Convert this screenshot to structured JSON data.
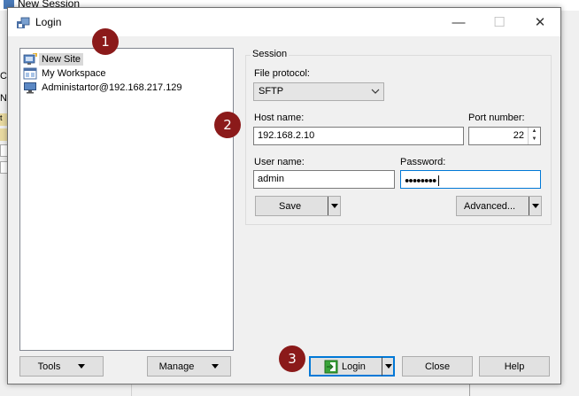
{
  "background_window": {
    "title": "New Session",
    "left_letters": [
      "C",
      "N",
      "t"
    ]
  },
  "dialog": {
    "title": "Login",
    "controls": {
      "minimize": "—",
      "maximize": "☐",
      "close": "✕"
    }
  },
  "tree": {
    "items": [
      {
        "label": "New Site",
        "icon": "new-site-icon",
        "selected": true
      },
      {
        "label": "My Workspace",
        "icon": "workspace-icon",
        "selected": false
      },
      {
        "label": "Administartor@192.168.217.129",
        "icon": "monitor-icon",
        "selected": false
      }
    ]
  },
  "session": {
    "legend": "Session",
    "file_protocol_label": "File protocol:",
    "file_protocol_value": "SFTP",
    "host_name_label": "Host name:",
    "host_name_value": "192.168.2.10",
    "port_label": "Port number:",
    "port_value": "22",
    "user_name_label": "User name:",
    "user_name_value": "admin",
    "password_label": "Password:",
    "password_value": "●●●●●●●●",
    "save_label": "Save",
    "advanced_label": "Advanced..."
  },
  "bottom": {
    "tools_label": "Tools",
    "manage_label": "Manage",
    "login_label": "Login",
    "close_label": "Close",
    "help_label": "Help"
  },
  "badges": [
    "1",
    "2",
    "3"
  ],
  "colors": {
    "badge": "#8b1a1a",
    "focus": "#0078d7",
    "login_icon": "#3aa43a"
  }
}
